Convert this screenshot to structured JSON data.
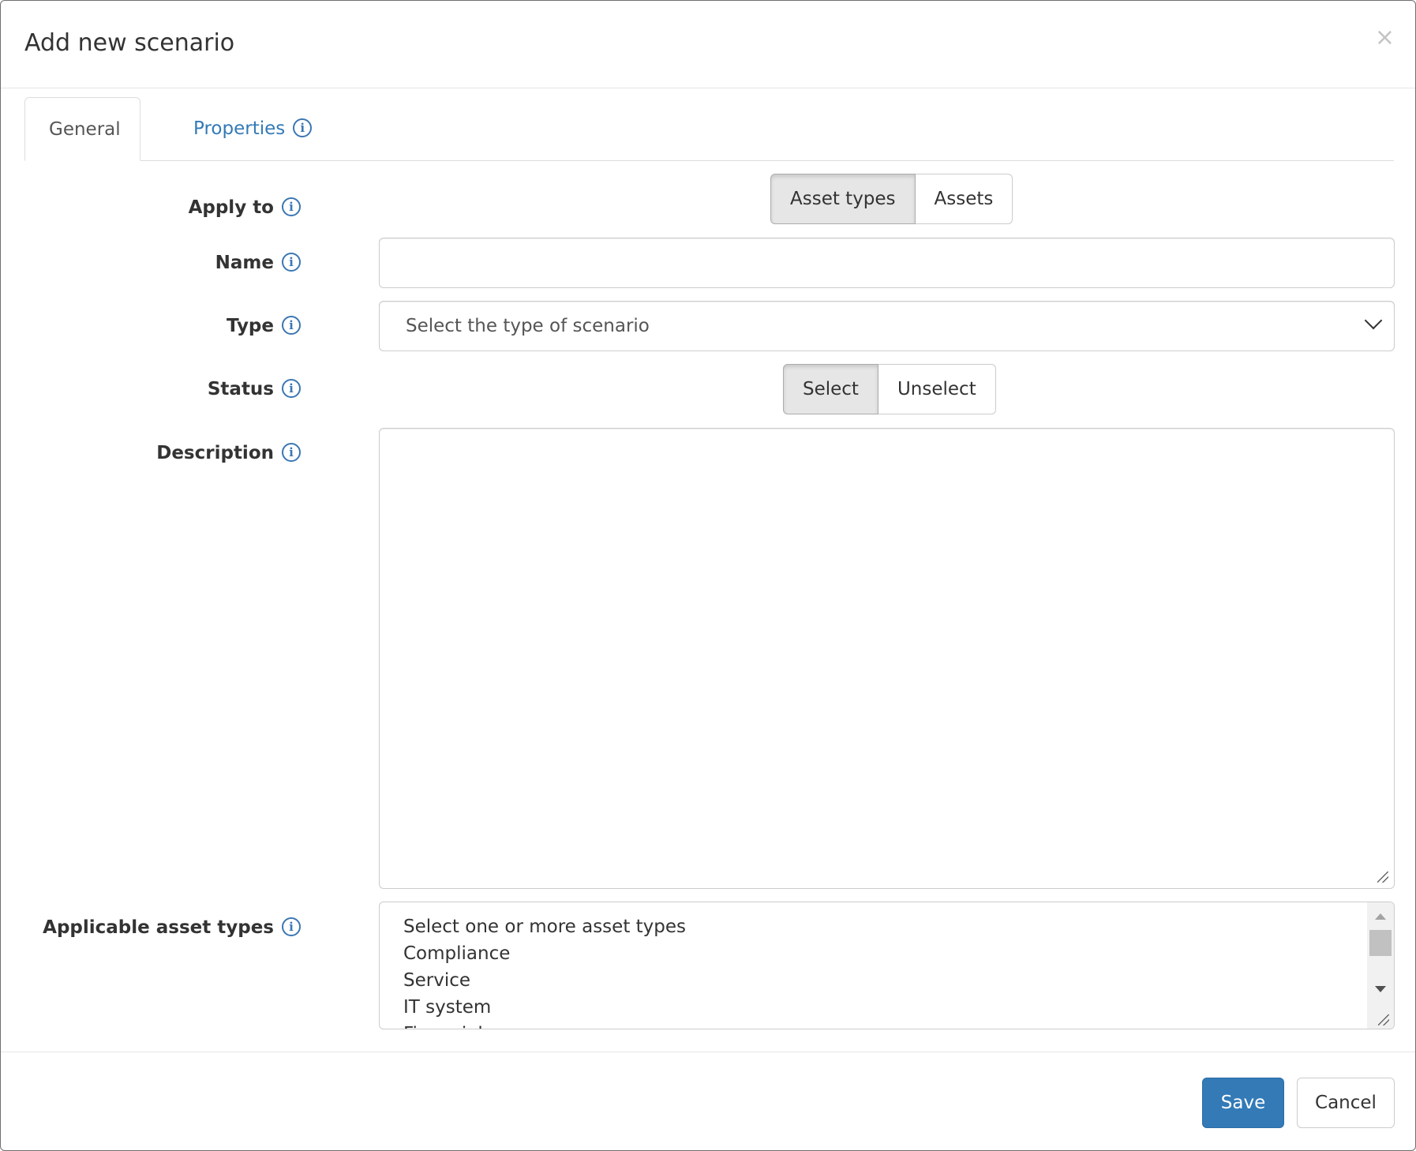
{
  "modal": {
    "title": "Add new scenario",
    "close_glyph": "×"
  },
  "tabs": [
    {
      "label": "General",
      "active": true
    },
    {
      "label": "Properties",
      "icon": "info-icon"
    }
  ],
  "info_glyph": "i",
  "form": {
    "apply_to": {
      "label": "Apply to",
      "options": [
        "Asset types",
        "Assets"
      ],
      "selected": "Asset types"
    },
    "name": {
      "label": "Name",
      "value": "",
      "placeholder": ""
    },
    "type": {
      "label": "Type",
      "selected": "Select the type of scenario"
    },
    "status": {
      "label": "Status",
      "options": [
        "Select",
        "Unselect"
      ],
      "selected": "Select"
    },
    "description": {
      "label": "Description",
      "value": ""
    },
    "applicable_asset_types": {
      "label": "Applicable asset types",
      "options": [
        "Select one or more asset types",
        "Compliance",
        "Service",
        "IT system",
        "Financial"
      ]
    }
  },
  "footer": {
    "save_label": "Save",
    "cancel_label": "Cancel"
  },
  "colors": {
    "primary": "#337ab7",
    "info_icon": "#3b76b3",
    "active_toggle": "#e6e6e6"
  }
}
